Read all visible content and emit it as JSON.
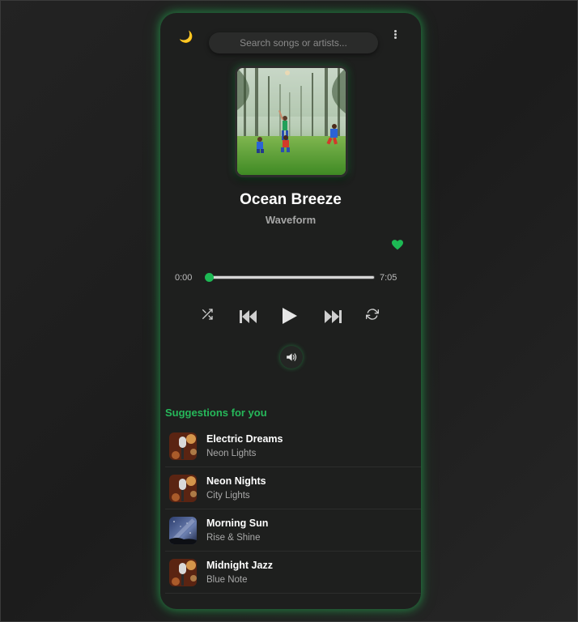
{
  "header": {
    "theme_icon": "moon-icon",
    "search_placeholder": "Search songs or artists...",
    "search_value": "",
    "menu_icon": "kebab-menu-icon"
  },
  "now_playing": {
    "title": "Ocean Breeze",
    "artist": "Waveform",
    "liked": true,
    "current_time": "0:00",
    "total_time": "7:05",
    "progress": 0.0
  },
  "controls": {
    "shuffle_icon": "shuffle-icon",
    "previous_icon": "skip-previous-icon",
    "play_icon": "play-icon",
    "next_icon": "skip-next-icon",
    "repeat_icon": "repeat-icon",
    "volume_icon": "volume-icon"
  },
  "suggestions": {
    "heading": "Suggestions for you",
    "items": [
      {
        "title": "Electric Dreams",
        "artist": "Neon Lights",
        "art": "microphone"
      },
      {
        "title": "Neon Nights",
        "artist": "City Lights",
        "art": "microphone"
      },
      {
        "title": "Morning Sun",
        "artist": "Rise & Shine",
        "art": "night-sky"
      },
      {
        "title": "Midnight Jazz",
        "artist": "Blue Note",
        "art": "microphone"
      }
    ]
  },
  "colors": {
    "accent": "#1db954",
    "background": "#1e1f1e",
    "glow": "#26c85a"
  }
}
